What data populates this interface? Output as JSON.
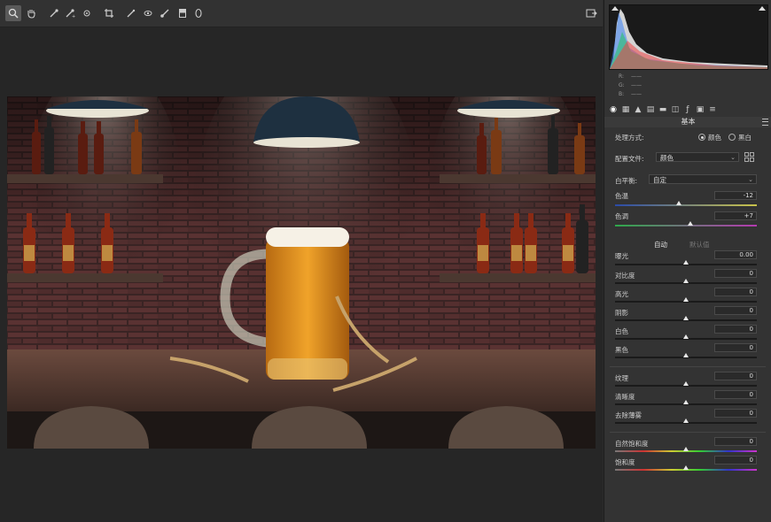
{
  "toolbar": {
    "tools": [
      {
        "name": "zoom-tool",
        "glyph": "🔍",
        "active": true
      },
      {
        "name": "hand-tool",
        "glyph": "✋",
        "active": false
      },
      {
        "name": "white-balance-tool",
        "glyph": "⟋",
        "active": false
      },
      {
        "name": "color-sampler-tool",
        "glyph": "⟋",
        "active": false
      },
      {
        "name": "targeted-adjustment-tool",
        "glyph": "◎",
        "active": false
      },
      {
        "name": "crop-tool",
        "glyph": "⌗",
        "active": false
      },
      {
        "name": "spot-removal-tool",
        "glyph": "⟋",
        "active": false
      },
      {
        "name": "red-eye-tool",
        "glyph": "⊙",
        "active": false
      },
      {
        "name": "adjustment-brush-tool",
        "glyph": "⟋",
        "active": false
      },
      {
        "name": "graduated-filter-tool",
        "glyph": "▤",
        "active": false
      },
      {
        "name": "radial-filter-tool",
        "glyph": "○",
        "active": false
      }
    ],
    "export_icon": "open-image-icon"
  },
  "histogram": {
    "r": "R:",
    "g": "G:",
    "b": "B:",
    "dash": "——"
  },
  "panel": {
    "section_title": "基本",
    "process_label": "处理方式:",
    "process_color": "颜色",
    "process_bw": "黑白",
    "profile_label": "配置文件:",
    "profile_value": "颜色",
    "wb_label": "白平衡:",
    "wb_value": "自定",
    "auto": "自动",
    "default": "默认值"
  },
  "sliders": {
    "temp": {
      "label": "色温",
      "value": "-12",
      "pos": 0.45
    },
    "tint": {
      "label": "色调",
      "value": "+7",
      "pos": 0.53
    },
    "exposure": {
      "label": "曝光",
      "value": "0.00",
      "pos": 0.5
    },
    "contrast": {
      "label": "对比度",
      "value": "0",
      "pos": 0.5
    },
    "highlights": {
      "label": "高光",
      "value": "0",
      "pos": 0.5
    },
    "shadows": {
      "label": "阴影",
      "value": "0",
      "pos": 0.5
    },
    "whites": {
      "label": "白色",
      "value": "0",
      "pos": 0.5
    },
    "blacks": {
      "label": "黑色",
      "value": "0",
      "pos": 0.5
    },
    "texture": {
      "label": "纹理",
      "value": "0",
      "pos": 0.5
    },
    "clarity": {
      "label": "清晰度",
      "value": "0",
      "pos": 0.5
    },
    "dehaze": {
      "label": "去除薄雾",
      "value": "0",
      "pos": 0.5
    },
    "vibrance": {
      "label": "自然饱和度",
      "value": "0",
      "pos": 0.5
    },
    "saturation": {
      "label": "饱和度",
      "value": "0",
      "pos": 0.5
    }
  },
  "colors": {
    "accent": "#e8e8e8",
    "panel": "#333333",
    "canvas": "#262626"
  }
}
